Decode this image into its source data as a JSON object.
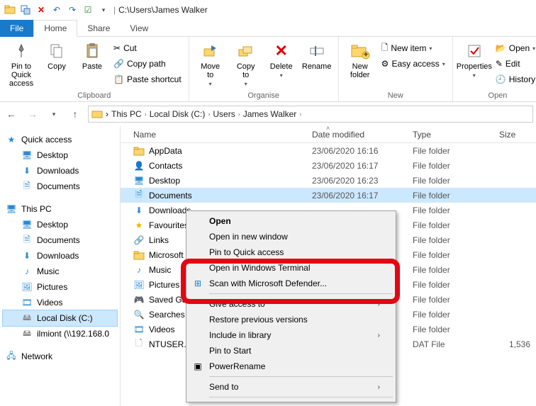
{
  "titlebar": {
    "path": "C:\\Users\\James Walker"
  },
  "tabs": {
    "file": "File",
    "home": "Home",
    "share": "Share",
    "view": "View"
  },
  "ribbon": {
    "pin": "Pin to Quick\naccess",
    "copy": "Copy",
    "paste": "Paste",
    "cut": "Cut",
    "copypath": "Copy path",
    "pastesc": "Paste shortcut",
    "moveto": "Move\nto",
    "copyto": "Copy\nto",
    "delete": "Delete",
    "rename": "Rename",
    "newfolder": "New\nfolder",
    "newitem": "New item",
    "easyaccess": "Easy access",
    "properties": "Properties",
    "open": "Open",
    "edit": "Edit",
    "history": "History",
    "g_clipboard": "Clipboard",
    "g_organise": "Organise",
    "g_new": "New",
    "g_open": "Open"
  },
  "breadcrumbs": [
    "This PC",
    "Local Disk (C:)",
    "Users",
    "James Walker"
  ],
  "nav": {
    "quickaccess": "Quick access",
    "qa_items": [
      "Desktop",
      "Downloads",
      "Documents"
    ],
    "thispc": "This PC",
    "pc_items": [
      "Desktop",
      "Documents",
      "Downloads",
      "Music",
      "Pictures",
      "Videos",
      "Local Disk (C:)",
      "ilmiont (\\\\192.168.0"
    ],
    "network": "Network"
  },
  "columns": {
    "name": "Name",
    "date": "Date modified",
    "type": "Type",
    "size": "Size"
  },
  "rows": [
    {
      "name": "AppData",
      "date": "23/06/2020 16:16",
      "type": "File folder",
      "size": "",
      "icon": "folder"
    },
    {
      "name": "Contacts",
      "date": "23/06/2020 16:17",
      "type": "File folder",
      "size": "",
      "icon": "contacts"
    },
    {
      "name": "Desktop",
      "date": "23/06/2020 16:23",
      "type": "File folder",
      "size": "",
      "icon": "desktop"
    },
    {
      "name": "Documents",
      "date": "23/06/2020 16:17",
      "type": "File folder",
      "size": "",
      "icon": "doc",
      "selected": true
    },
    {
      "name": "Downloads",
      "date": "",
      "type": "File folder",
      "size": "",
      "icon": "down"
    },
    {
      "name": "Favourites",
      "date": "",
      "type": "File folder",
      "size": "",
      "icon": "star"
    },
    {
      "name": "Links",
      "date": "",
      "type": "File folder",
      "size": "",
      "icon": "link"
    },
    {
      "name": "Microsoft",
      "date": "",
      "type": "File folder",
      "size": "",
      "icon": "folder"
    },
    {
      "name": "Music",
      "date": "",
      "type": "File folder",
      "size": "",
      "icon": "music"
    },
    {
      "name": "Pictures",
      "date": "",
      "type": "File folder",
      "size": "",
      "icon": "pic"
    },
    {
      "name": "Saved Games",
      "date": "",
      "type": "File folder",
      "size": "",
      "icon": "game"
    },
    {
      "name": "Searches",
      "date": "",
      "type": "File folder",
      "size": "",
      "icon": "search"
    },
    {
      "name": "Videos",
      "date": "",
      "type": "File folder",
      "size": "",
      "icon": "video"
    },
    {
      "name": "NTUSER.DAT",
      "date": "",
      "type": "DAT File",
      "size": "1,536",
      "icon": "file"
    }
  ],
  "ctx": {
    "open": "Open",
    "opennew": "Open in new window",
    "pinqa": "Pin to Quick access",
    "openwt": "Open in Windows Terminal",
    "defender": "Scan with Microsoft Defender...",
    "giveaccess": "Give access to",
    "restore": "Restore previous versions",
    "library": "Include in library",
    "pinstart": "Pin to Start",
    "powerrename": "PowerRename",
    "sendto": "Send to"
  }
}
